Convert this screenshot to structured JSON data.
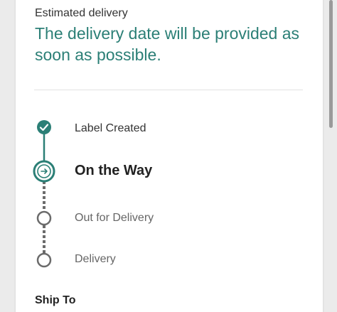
{
  "delivery": {
    "estimate_label": "Estimated delivery",
    "estimate_message": "The delivery date will be provided as soon as possible."
  },
  "tracking": {
    "steps": [
      {
        "label": "Label Created",
        "status": "completed",
        "icon": "check-icon"
      },
      {
        "label": "On the Way",
        "status": "current",
        "icon": "arrow-right-icon"
      },
      {
        "label": "Out for Delivery",
        "status": "pending",
        "icon": "empty-circle-icon"
      },
      {
        "label": "Delivery",
        "status": "pending",
        "icon": "empty-circle-icon"
      }
    ]
  },
  "section": {
    "ship_to_label": "Ship To"
  },
  "colors": {
    "accent": "#2b7f76",
    "pending": "#6b6b6b"
  }
}
